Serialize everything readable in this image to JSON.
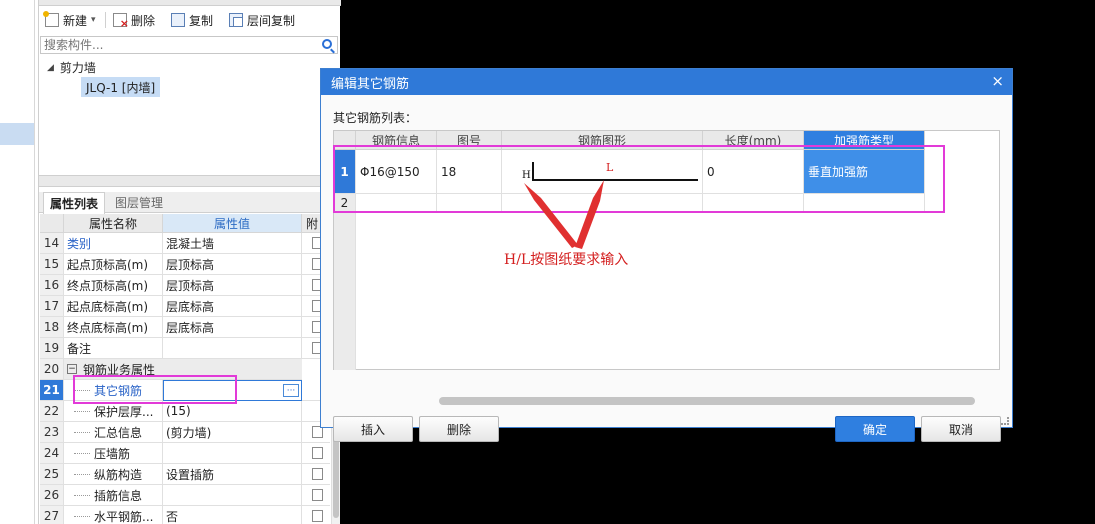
{
  "toolbar": {
    "new_label": "新建",
    "delete_label": "删除",
    "copy_label": "复制",
    "floor_copy_label": "层间复制"
  },
  "search": {
    "placeholder": "搜索构件..."
  },
  "tree": {
    "root_label": "剪力墙",
    "child_label": "JLQ-1 [内墙]"
  },
  "prop_tabs": {
    "attributes": "属性列表",
    "layers": "图层管理"
  },
  "prop_table": {
    "headers": {
      "name": "属性名称",
      "value": "属性值",
      "extra": "附"
    },
    "rows": [
      {
        "num": "14",
        "name": "类别",
        "value": "混凝土墙"
      },
      {
        "num": "15",
        "name": "起点顶标高(m)",
        "value": "层顶标高"
      },
      {
        "num": "16",
        "name": "终点顶标高(m)",
        "value": "层顶标高"
      },
      {
        "num": "17",
        "name": "起点底标高(m)",
        "value": "层底标高"
      },
      {
        "num": "18",
        "name": "终点底标高(m)",
        "value": "层底标高"
      },
      {
        "num": "19",
        "name": "备注",
        "value": ""
      },
      {
        "num": "20",
        "name": "钢筋业务属性",
        "value": ""
      },
      {
        "num": "21",
        "name": "其它钢筋",
        "value": ""
      },
      {
        "num": "22",
        "name": "保护层厚...",
        "value": "(15)"
      },
      {
        "num": "23",
        "name": "汇总信息",
        "value": "(剪力墙)"
      },
      {
        "num": "24",
        "name": "压墙筋",
        "value": ""
      },
      {
        "num": "25",
        "name": "纵筋构造",
        "value": "设置插筋"
      },
      {
        "num": "26",
        "name": "插筋信息",
        "value": ""
      },
      {
        "num": "27",
        "name": "水平钢筋...",
        "value": "否"
      }
    ]
  },
  "dialog": {
    "title": "编辑其它钢筋",
    "close_icon": "×",
    "list_label": "其它钢筋列表：",
    "columns": {
      "info": "钢筋信息",
      "figure_no": "图号",
      "shape": "钢筋图形",
      "length": "长度(mm)",
      "type": "加强筋类型"
    },
    "rows": [
      {
        "num": "1",
        "info": "Φ16@150",
        "figure_no": "18",
        "shape_h": "H",
        "shape_l": "L",
        "length": "0",
        "type": "垂直加强筋"
      },
      {
        "num": "2",
        "info": "",
        "figure_no": "",
        "shape_h": "",
        "shape_l": "",
        "length": "",
        "type": ""
      }
    ],
    "annotation": "H/L按图纸要求输入",
    "buttons": {
      "insert": "插入",
      "delete": "删除",
      "ok": "确定",
      "cancel": "取消"
    }
  },
  "colors": {
    "accent": "#2f79d8",
    "highlight_pink": "#e23ad8",
    "annotation_red": "#d42020"
  }
}
